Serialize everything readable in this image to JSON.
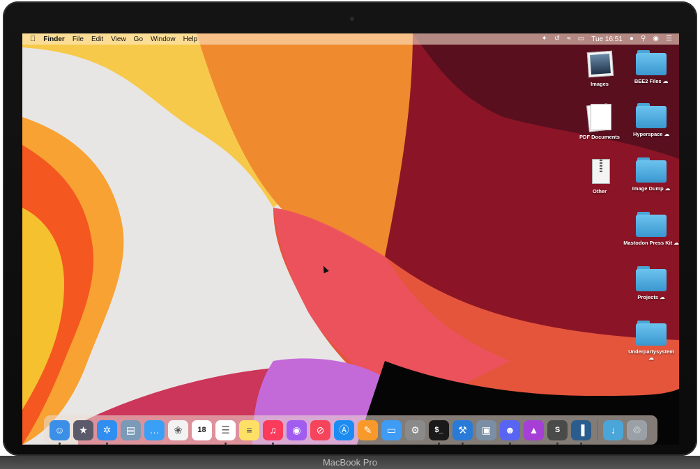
{
  "device": {
    "model_label": "MacBook Pro"
  },
  "menubar": {
    "apple_icon": "apple-logo",
    "app_name": "Finder",
    "items": [
      "File",
      "Edit",
      "View",
      "Go",
      "Window",
      "Help"
    ],
    "status_icons": [
      "bluetooth-icon",
      "time-machine-icon",
      "wifi-icon",
      "battery-icon"
    ],
    "clock": "Tue 16:51",
    "right_icons": [
      "record-dot-icon",
      "spotlight-search-icon",
      "siri-icon",
      "notification-center-icon"
    ]
  },
  "desktop": {
    "items": [
      {
        "label": "Images",
        "kind": "photo"
      },
      {
        "label": "BEE2 Files",
        "kind": "folder",
        "cloud": true
      },
      {
        "label": "PDF Documents",
        "kind": "docs"
      },
      {
        "label": "Hyperspace",
        "kind": "folder",
        "cloud": true
      },
      {
        "label": "Other",
        "kind": "zip"
      },
      {
        "label": "Image Dump",
        "kind": "folder",
        "cloud": true
      },
      {
        "label": "Mastodon Press Kit",
        "kind": "folder",
        "cloud": true
      },
      {
        "label": "Projects",
        "kind": "folder",
        "cloud": true
      },
      {
        "label": "Underpartysystem",
        "kind": "folder",
        "cloud": true
      }
    ],
    "cloud_glyph": "☁"
  },
  "dock": {
    "apps": [
      {
        "name": "Finder",
        "icon": "finder-icon",
        "color": "#3b8fe6",
        "running": true
      },
      {
        "name": "Launchpad",
        "icon": "launchpad-icon",
        "color": "#5a5a6a",
        "running": false
      },
      {
        "name": "Safari",
        "icon": "safari-icon",
        "color": "#2f8ef0",
        "running": true
      },
      {
        "name": "Preview",
        "icon": "preview-icon",
        "color": "#7a9ab7",
        "running": false
      },
      {
        "name": "Messages",
        "icon": "messages-icon",
        "color": "#3aa0f5",
        "running": false
      },
      {
        "name": "Photos",
        "icon": "photos-icon",
        "color": "#f2f2f2",
        "running": false
      },
      {
        "name": "Calendar",
        "icon": "calendar-icon",
        "color": "#ffffff",
        "running": false,
        "text": "18"
      },
      {
        "name": "Reminders",
        "icon": "reminders-icon",
        "color": "#ffffff",
        "running": true
      },
      {
        "name": "Notes",
        "icon": "notes-icon",
        "color": "#ffe066",
        "running": false
      },
      {
        "name": "Music",
        "icon": "music-icon",
        "color": "#fb3b5c",
        "running": true
      },
      {
        "name": "Podcasts",
        "icon": "podcasts-icon",
        "color": "#a15cf0",
        "running": false
      },
      {
        "name": "News",
        "icon": "news-icon",
        "color": "#f5445b",
        "running": false
      },
      {
        "name": "App Store",
        "icon": "app-store-icon",
        "color": "#1c8cf2",
        "running": false
      },
      {
        "name": "Pages",
        "icon": "pages-icon",
        "color": "#f79a2b",
        "running": false
      },
      {
        "name": "Keynote",
        "icon": "keynote-icon",
        "color": "#3f9cf5",
        "running": false
      },
      {
        "name": "System Preferences",
        "icon": "system-preferences-icon",
        "color": "#8a8a8a",
        "running": false
      },
      {
        "name": "Terminal",
        "icon": "terminal-icon",
        "color": "#1a1a1a",
        "running": true,
        "text": "$_"
      },
      {
        "name": "Xcode",
        "icon": "xcode-icon",
        "color": "#2a7bd8",
        "running": true
      },
      {
        "name": "Image Capture",
        "icon": "image-capture-icon",
        "color": "#7a8fa5",
        "running": false
      },
      {
        "name": "Discord",
        "icon": "discord-icon",
        "color": "#5865f2",
        "running": true
      },
      {
        "name": "Affinity Photo",
        "icon": "affinity-photo-icon",
        "color": "#a63fd6",
        "running": false
      },
      {
        "name": "Sublime Text",
        "icon": "sublime-text-icon",
        "color": "#4a4a4a",
        "running": true,
        "text": "S"
      },
      {
        "name": "iStat Menus",
        "icon": "equalizer-icon",
        "color": "#2b5c8e",
        "running": true
      }
    ],
    "trailing": [
      {
        "name": "Downloads",
        "icon": "downloads-folder-icon",
        "color": "#4aa6d8"
      },
      {
        "name": "Trash",
        "icon": "trash-icon",
        "color": "#9aa0a6"
      }
    ]
  }
}
